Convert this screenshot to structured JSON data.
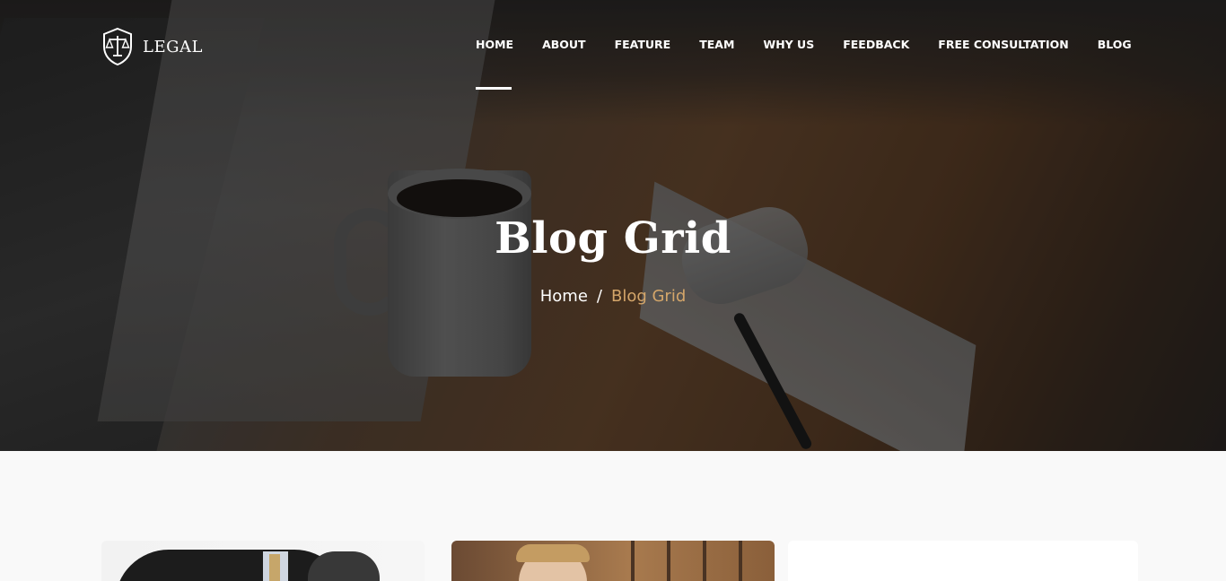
{
  "brand": {
    "name": "LEGAL",
    "icon": "scales-shield-icon"
  },
  "nav": {
    "items": [
      {
        "label": "HOME",
        "active": true
      },
      {
        "label": "ABOUT"
      },
      {
        "label": "FEATURE"
      },
      {
        "label": "TEAM"
      },
      {
        "label": "WHY US"
      },
      {
        "label": "FEEDBACK"
      },
      {
        "label": "FREE CONSULTATION"
      },
      {
        "label": "BLOG"
      }
    ]
  },
  "hero": {
    "title": "Blog Grid",
    "breadcrumb": {
      "home": "Home",
      "separator": "/",
      "current": "Blog Grid"
    }
  },
  "colors": {
    "accent": "#d4a66a",
    "nav_text": "#ffffff",
    "page_bg": "#f9f9f9"
  }
}
